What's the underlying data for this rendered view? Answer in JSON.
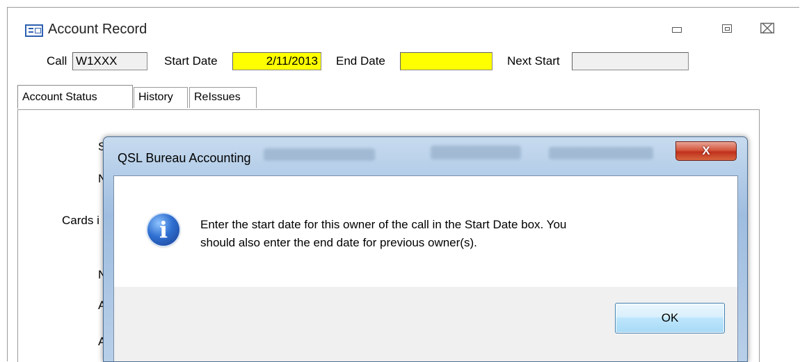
{
  "window": {
    "title": "Account Record",
    "controls": {
      "minimize": "minimize",
      "restore": "restore",
      "close": "close"
    }
  },
  "fields": {
    "call_label": "Call",
    "call_value": "W1XXX",
    "start_date_label": "Start Date",
    "start_date_value": "2/11/2013",
    "end_date_label": "End Date",
    "end_date_value": "",
    "next_start_label": "Next Start",
    "next_start_value": ""
  },
  "tabs": [
    {
      "label": "Account Status",
      "active": true
    },
    {
      "label": "History",
      "active": false
    },
    {
      "label": "ReIssues",
      "active": false
    }
  ],
  "panel_fragments": {
    "s": "S",
    "n1": "N",
    "cards": "Cards i",
    "n2": "N",
    "a1": "A",
    "a2": "A"
  },
  "dialog": {
    "title": "QSL Bureau Accounting",
    "close_glyph": "X",
    "message_line1": "Enter the start date for this owner of the call in the Start Date box.  You",
    "message_line2": "should also enter the end date for previous owner(s).",
    "icon": "info-icon",
    "ok_label": "OK"
  },
  "colors": {
    "highlight_field": "#ffff00",
    "dialog_frame": "#a9c4e0",
    "close_button": "#c7432f"
  }
}
